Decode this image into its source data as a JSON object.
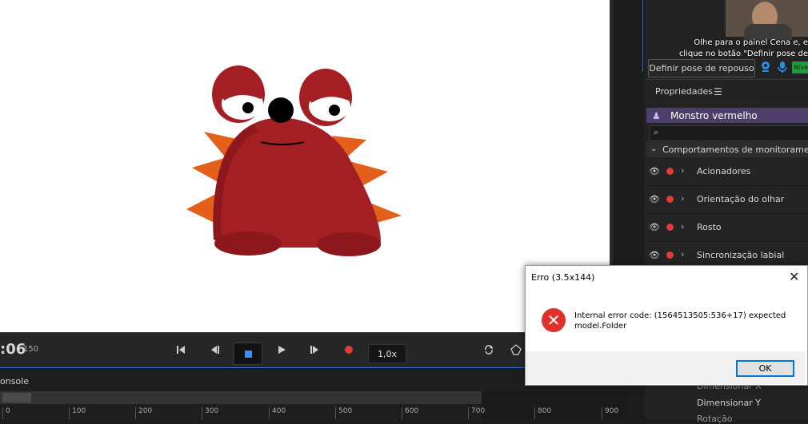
{
  "stage": {
    "puppet_description_colors": {
      "body": "#a41f24",
      "spikes": "#e35f1a",
      "eye_white": "#ffffff"
    }
  },
  "transport": {
    "timecode": ":06",
    "frame_count": "150",
    "speed": "1,0x",
    "icons": [
      "skip-to-start-icon",
      "step-back-icon",
      "stop-icon",
      "play-icon",
      "step-forward-icon",
      "record-icon",
      "loop-icon",
      "snapshot-icon"
    ]
  },
  "timeline": {
    "panel_label": "onsole",
    "ticks": [
      "0",
      "100",
      "200",
      "300",
      "400",
      "500",
      "600",
      "700",
      "800",
      "900"
    ]
  },
  "right_panel": {
    "subtitle_line1": "Olhe para o painel Cena e, e",
    "subtitle_line2": "clique no botão \"Definir pose de",
    "rest_pose_button": "Definir pose de repouso",
    "level_badge": "Níve",
    "properties_title": "Propriedades",
    "puppet_name": "Monstro vermelho",
    "group_label": "Comportamentos de monitoramento",
    "behaviors": [
      {
        "label": "Acionadores"
      },
      {
        "label": "Orientação do olhar"
      },
      {
        "label": "Rosto"
      },
      {
        "label": "Sincronização labial"
      }
    ],
    "params": [
      "Dimensionar X",
      "Dimensionar Y",
      "Rotação"
    ]
  },
  "dialog": {
    "title": "Erro (3.5x144)",
    "message": "Internal error code: (1564513505:536+17) expected model.Folder",
    "ok_label": "OK"
  },
  "colors": {
    "accent_blue": "#3b8fff",
    "record_red": "#e8383c",
    "puppet_bar": "#4b3e6b",
    "error_red": "#e0302c"
  }
}
